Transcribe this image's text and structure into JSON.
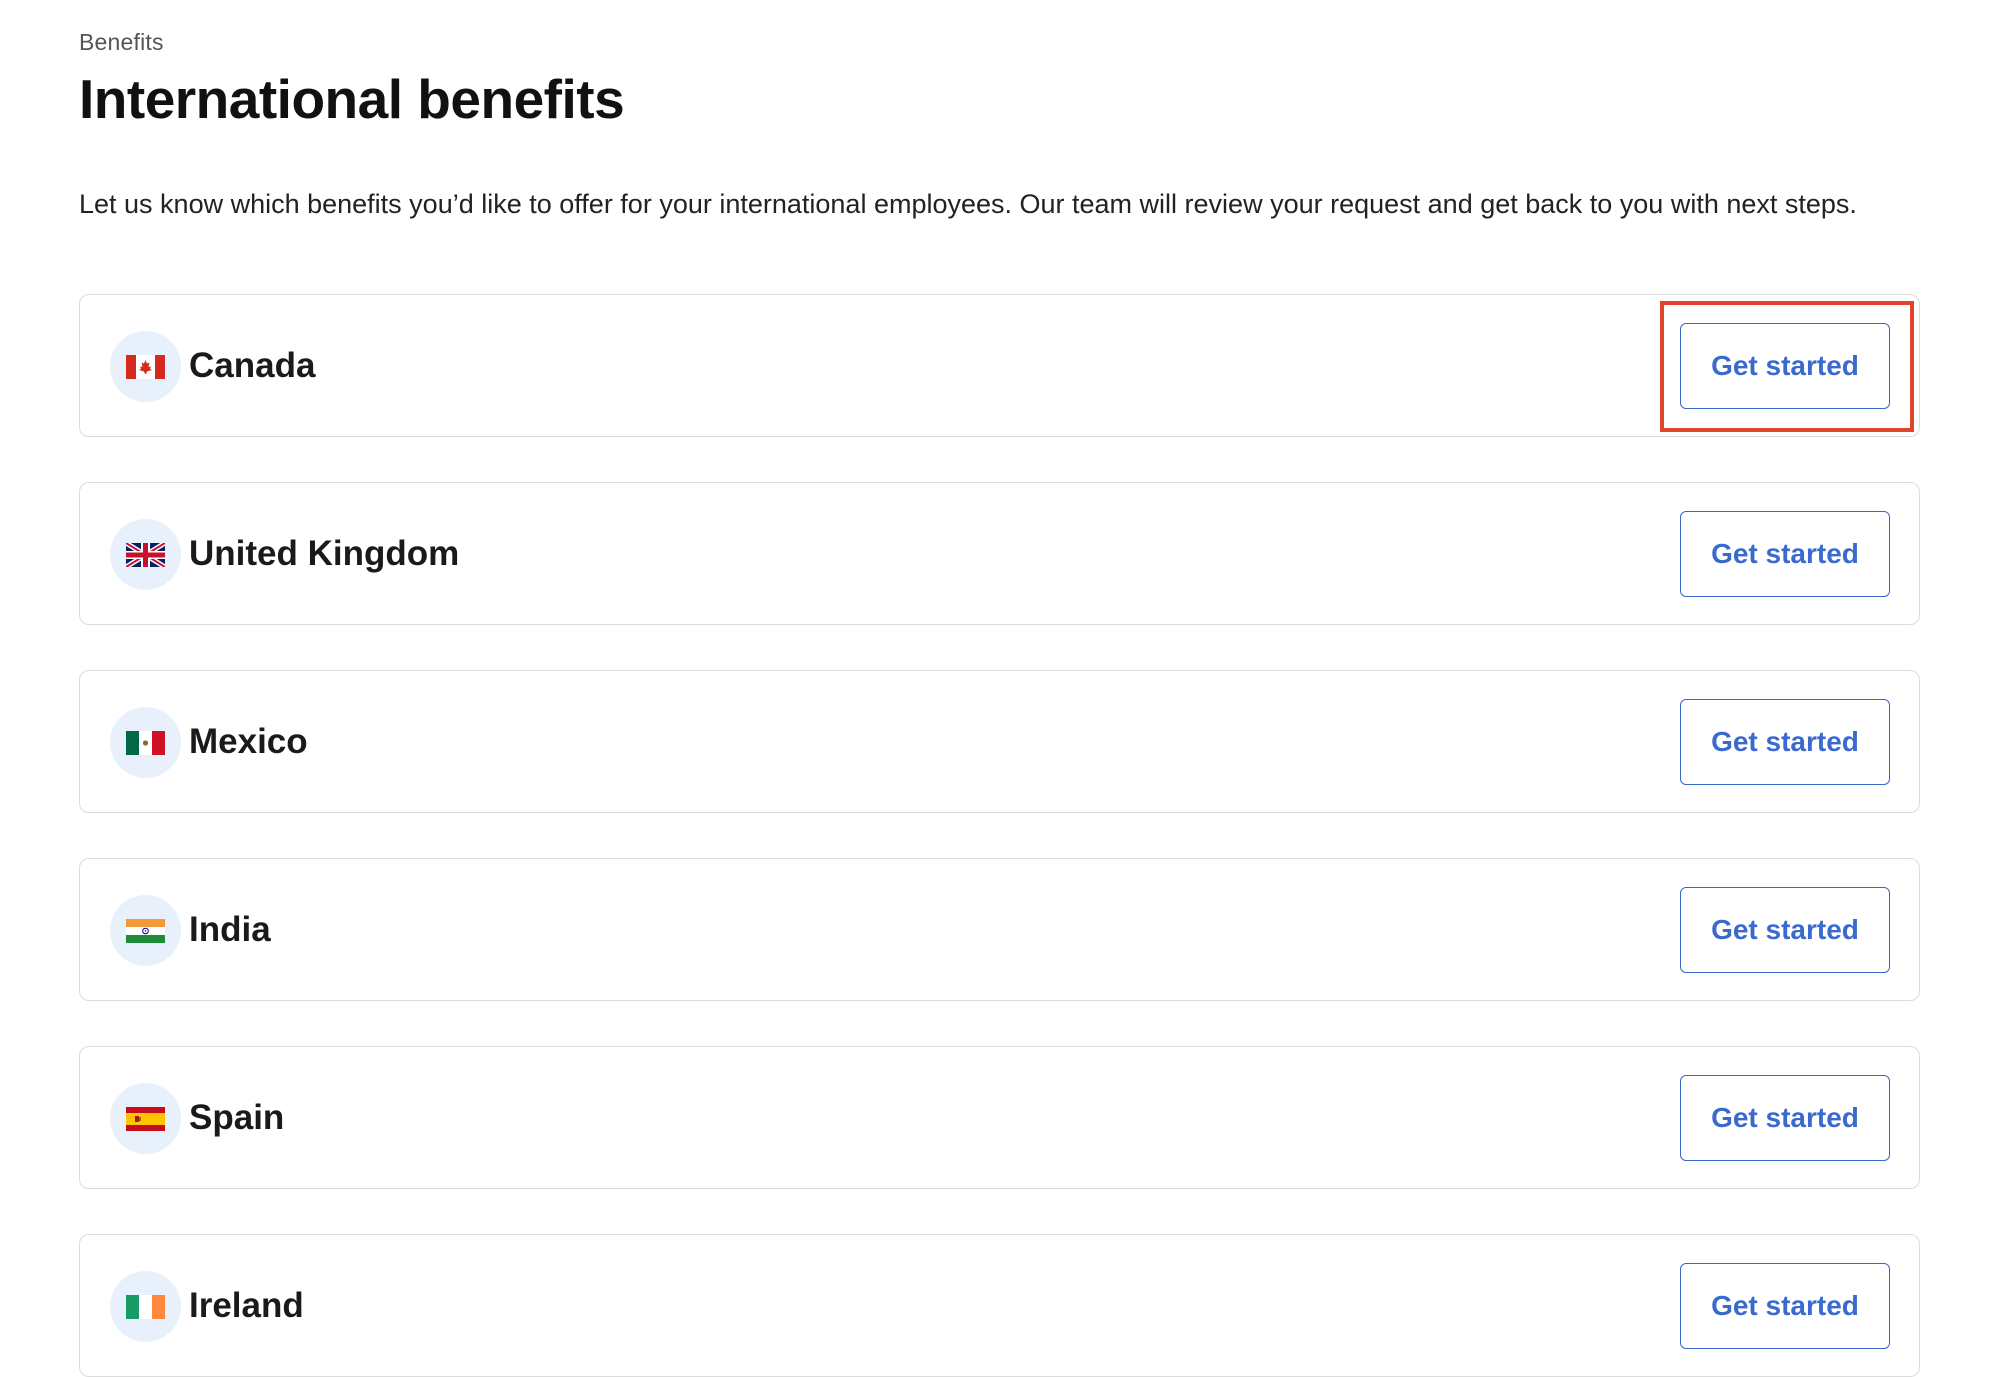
{
  "breadcrumb": "Benefits",
  "title": "International benefits",
  "intro": "Let us know which benefits you’d like to offer for your international employees. Our team will review your request and get back to you with next steps.",
  "countries": [
    {
      "name": "Canada",
      "flag_icon": "canada-flag-icon",
      "button_label": "Get started"
    },
    {
      "name": "United Kingdom",
      "flag_icon": "uk-flag-icon",
      "button_label": "Get started"
    },
    {
      "name": "Mexico",
      "flag_icon": "mexico-flag-icon",
      "button_label": "Get started"
    },
    {
      "name": "India",
      "flag_icon": "india-flag-icon",
      "button_label": "Get started"
    },
    {
      "name": "Spain",
      "flag_icon": "spain-flag-icon",
      "button_label": "Get started"
    },
    {
      "name": "Ireland",
      "flag_icon": "ireland-flag-icon",
      "button_label": "Get started"
    }
  ],
  "colors": {
    "accent": "#3a6ad0",
    "highlight": "#e0442a",
    "flag_circle_bg": "#e8f1fb",
    "card_border": "#dcdcdc"
  }
}
